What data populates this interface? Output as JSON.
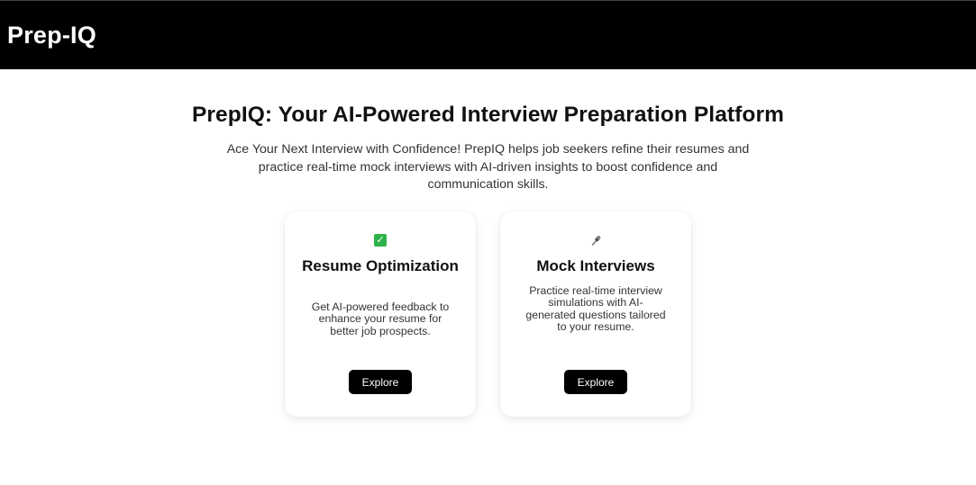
{
  "navbar": {
    "brand": "Prep-IQ"
  },
  "hero": {
    "title": "PrepIQ: Your AI-Powered Interview Preparation Platform",
    "subtitle": "Ace Your Next Interview with Confidence! PrepIQ helps job seekers refine their resumes and practice real-time mock interviews with AI-driven insights to boost confidence and communication skills."
  },
  "features": [
    {
      "icon": "check-mark-icon",
      "icon_color": "#2db34a",
      "title": "Resume Optimization",
      "description": "Get AI-powered feedback to enhance your resume for better job prospects.",
      "button_label": "Explore"
    },
    {
      "icon": "microphone-icon",
      "title": "Mock Interviews",
      "description": "Practice real-time interview simulations with AI-generated questions tailored to your resume.",
      "button_label": "Explore"
    }
  ],
  "colors": {
    "navbar_bg": "#000000",
    "button_bg": "#000000",
    "button_text": "#ffffff"
  }
}
